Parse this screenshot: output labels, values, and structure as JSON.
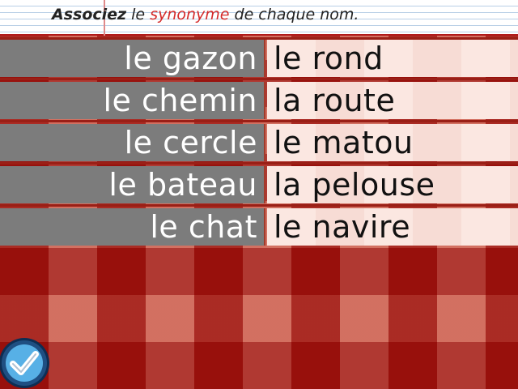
{
  "instruction": {
    "part1": "Associez",
    "part2": " le ",
    "part3": "synonyme",
    "part4": " de chaque nom."
  },
  "colors": {
    "header_accent": "#d42a2a",
    "left_cells": "#7c7c7c",
    "right_cells": "#fbe7e1",
    "tablecloth": "#c84e3b"
  },
  "left_words": [
    "le gazon",
    "le chemin",
    "le cercle",
    "le bateau",
    "le chat"
  ],
  "right_words": [
    "le rond",
    "la route",
    "le matou",
    "la pelouse",
    "le navire"
  ],
  "check_button": {
    "icon": "checkmark-icon"
  }
}
